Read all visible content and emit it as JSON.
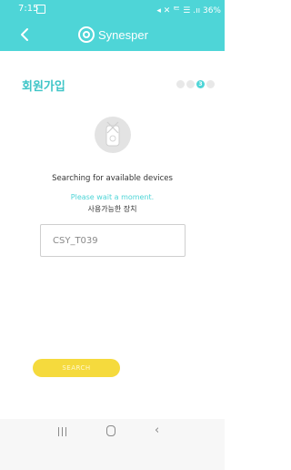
{
  "status_bar": {
    "time": "7:15",
    "right": "◀ ✕ ᄄ ☰ .ıı 36%"
  },
  "app_bar": {
    "logo_text": "Synesper"
  },
  "page": {
    "title": "회원가입",
    "steps": [
      "",
      "",
      "3",
      ""
    ],
    "active_step": 3
  },
  "search": {
    "status": "Searching for available devices",
    "wait": "Please wait a moment.",
    "available_label": "사용가능한 장치",
    "device_value": "CSY_T039",
    "button_label": "SEARCH"
  },
  "colors": {
    "accent": "#4ed5d7",
    "button": "#f5da3d"
  }
}
